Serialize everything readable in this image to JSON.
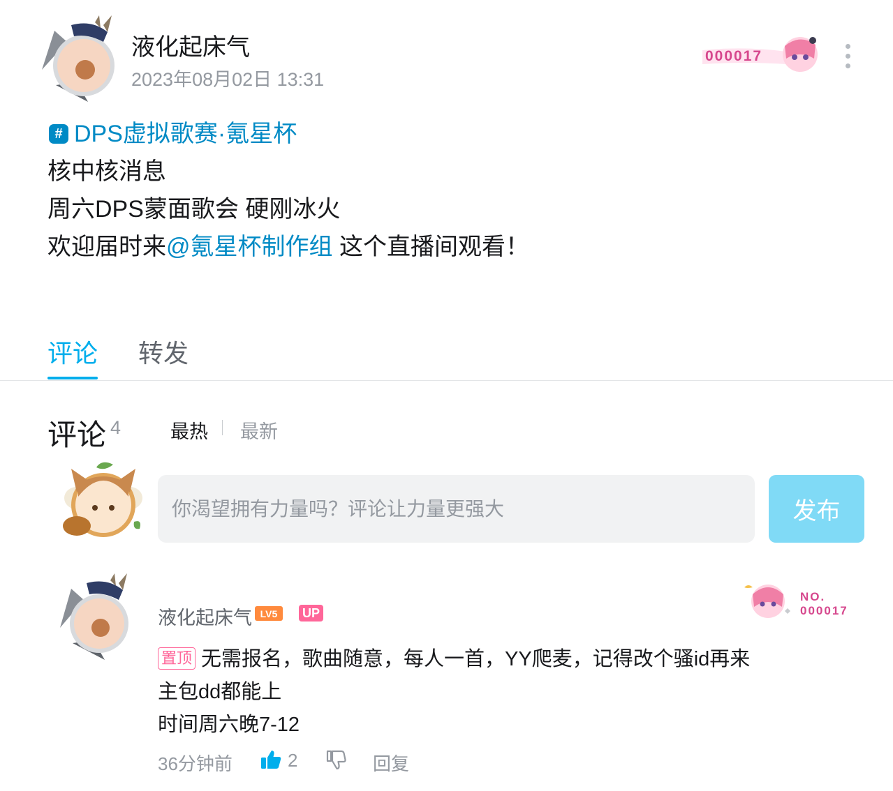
{
  "post": {
    "author": "液化起床气",
    "time": "2023年08月02日 13:31",
    "fan_badge_number": "000017",
    "topic_icon": "#",
    "topic": "DPS虚拟歌赛·氪星杯",
    "line1": "核中核消息",
    "line2": "周六DPS蒙面歌会 硬刚冰火",
    "line3_prefix": "欢迎届时来",
    "mention": "@氪星杯制作组",
    "line3_suffix": " 这个直播间观看！"
  },
  "tabs": {
    "comment": "评论",
    "forward": "转发"
  },
  "comments_section": {
    "title": "评论",
    "count": "4",
    "sort_hot": "最热",
    "sort_new": "最新",
    "input_placeholder": "你渴望拥有力量吗？评论让力量更强大",
    "publish": "发布"
  },
  "comment": {
    "name": "液化起床气",
    "level": "LV5",
    "up_tag": "UP",
    "fan_badge_no": "NO.",
    "fan_badge_number": "000017",
    "pin_tag": "置顶",
    "line1": "无需报名，歌曲随意，每人一首，YY爬麦，记得改个骚id再来",
    "line2": "主包dd都能上",
    "line3": "时间周六晚7-12",
    "time": "36分钟前",
    "likes": "2",
    "reply": "回复"
  },
  "colors": {
    "accent": "#00aeec",
    "link": "#008ac5",
    "pink": "#ff6699",
    "publish_bg": "#80daf6",
    "muted": "#9499a0"
  },
  "icons": [
    "more-vertical-icon",
    "topic-hash-icon",
    "thumb-up-icon",
    "thumb-down-icon"
  ]
}
